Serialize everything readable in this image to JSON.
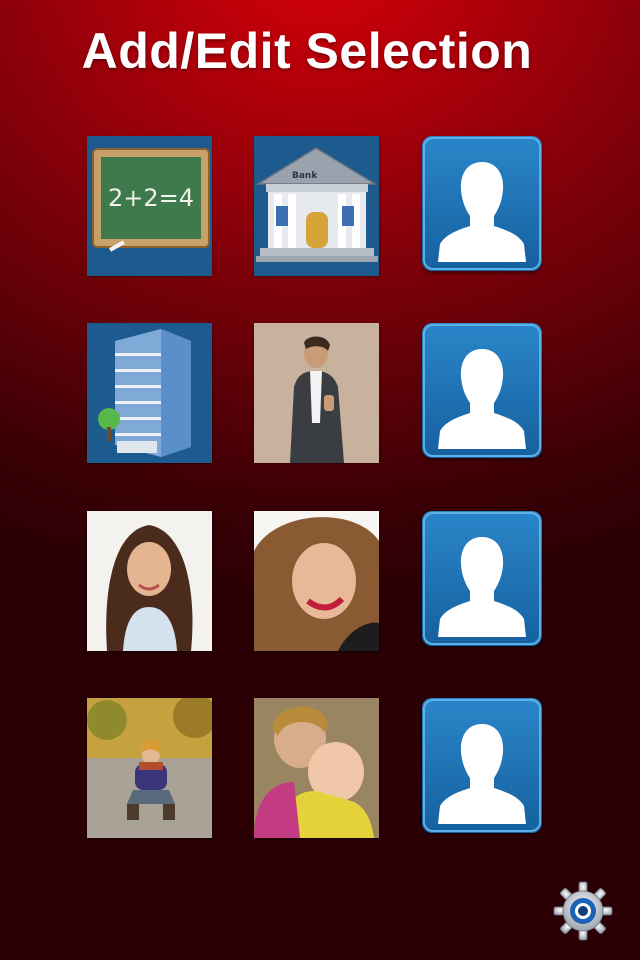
{
  "header": {
    "title": "Add/Edit Selection"
  },
  "tiles": [
    {
      "kind": "school",
      "icon": "chalkboard-icon",
      "chalk_text": "2+2=4",
      "background": "#1d5b8e"
    },
    {
      "kind": "bank",
      "icon": "bank-building-icon",
      "sign_text": "Bank",
      "background": "#1d5b8e"
    },
    {
      "kind": "empty",
      "icon": "person-silhouette-icon"
    },
    {
      "kind": "office",
      "icon": "office-building-icon",
      "background": "#1d5b8e"
    },
    {
      "kind": "photo",
      "icon": "man-in-suit-photo"
    },
    {
      "kind": "empty",
      "icon": "person-silhouette-icon"
    },
    {
      "kind": "photo",
      "icon": "young-woman-photo"
    },
    {
      "kind": "photo",
      "icon": "smiling-woman-photo"
    },
    {
      "kind": "empty",
      "icon": "person-silhouette-icon"
    },
    {
      "kind": "photo",
      "icon": "woman-autumn-road-photo"
    },
    {
      "kind": "photo",
      "icon": "mother-and-baby-photo"
    },
    {
      "kind": "empty",
      "icon": "person-silhouette-icon"
    }
  ],
  "settings": {
    "icon": "gear-icon"
  },
  "colors": {
    "background_top": "#d60008",
    "background_bottom": "#2a0004",
    "placeholder_blue": "#1e6fb0",
    "text": "#ffffff"
  }
}
